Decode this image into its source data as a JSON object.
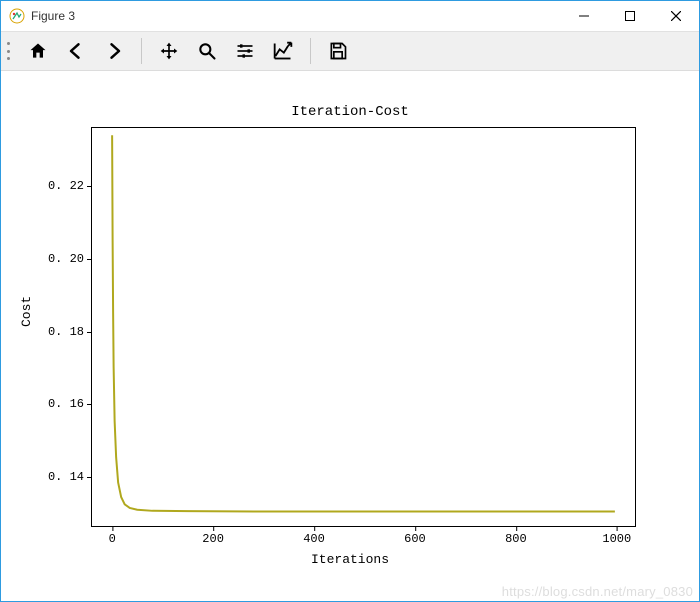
{
  "window": {
    "title": "Figure 3"
  },
  "toolbar": {
    "home": "home-icon",
    "back": "back-icon",
    "forward": "forward-icon",
    "pan": "move-icon",
    "zoom": "zoom-icon",
    "configure": "sliders-icon",
    "edit_axes": "axes-icon",
    "save": "save-icon"
  },
  "chart_data": {
    "type": "line",
    "title": "Iteration-Cost",
    "xlabel": "Iterations",
    "ylabel": "Cost",
    "xlim": [
      -40,
      1040
    ],
    "ylim": [
      0.126,
      0.236
    ],
    "xticks": [
      0,
      200,
      400,
      600,
      800,
      1000
    ],
    "yticks": [
      0.14,
      0.16,
      0.18,
      0.2,
      0.22
    ],
    "ytick_labels": [
      "0. 14",
      "0. 16",
      "0. 18",
      "0. 20",
      "0. 22"
    ],
    "series": [
      {
        "name": "cost",
        "color": "#b0a81e",
        "x": [
          0,
          1,
          2,
          3,
          5,
          8,
          12,
          18,
          25,
          35,
          50,
          80,
          150,
          300,
          500,
          700,
          1000
        ],
        "values": [
          0.234,
          0.205,
          0.185,
          0.17,
          0.155,
          0.145,
          0.138,
          0.134,
          0.132,
          0.131,
          0.1305,
          0.1302,
          0.1301,
          0.13,
          0.13,
          0.13,
          0.13
        ]
      }
    ]
  },
  "watermark": "https://blog.csdn.net/mary_0830"
}
